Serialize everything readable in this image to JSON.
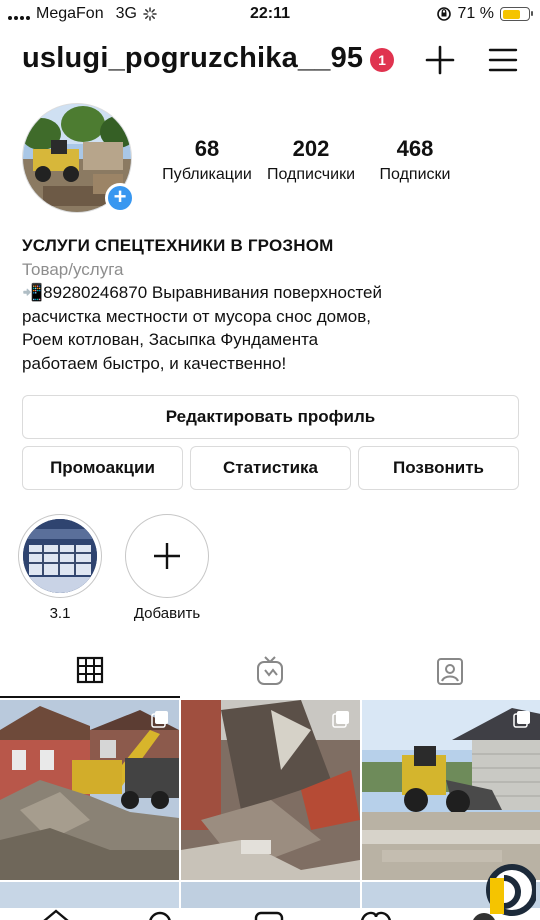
{
  "status_bar": {
    "carrier": "MegaFon",
    "network": "3G",
    "time": "22:11",
    "battery": "71 %",
    "battery_level": 0.71
  },
  "header": {
    "username": "uslugi_pogruzchika__95",
    "notification_count": "1",
    "icons": [
      "plus-icon",
      "menu-icon"
    ]
  },
  "profile": {
    "stats": [
      {
        "value": "68",
        "label": "Публикации"
      },
      {
        "value": "202",
        "label": "Подписчики"
      },
      {
        "value": "468",
        "label": "Подписки"
      }
    ]
  },
  "bio": {
    "name": "УСЛУГИ СПЕЦТЕХНИКИ В ГРОЗНОМ",
    "category": "Товар/услуга",
    "lines": [
      "📲89280246870 Выравнивания поверхностей",
      "расчистка местности от мусора снос домов,",
      "Роем котлован, Засыпка Фундамента",
      "работаем быстро, и качественно!"
    ]
  },
  "buttons": {
    "edit_profile": "Редактировать профиль",
    "promotions": "Промоакции",
    "insights": "Статистика",
    "call": "Позвонить"
  },
  "highlights": [
    {
      "label": "3.1"
    },
    {
      "label": "Добавить"
    }
  ],
  "tabs": [
    "grid-icon",
    "igtv-icon",
    "tagged-icon"
  ],
  "colors": {
    "badge": "#e0334f",
    "add_story": "#3897f0",
    "battery_fill": "#f5c400",
    "secondary_text": "#8e8e8e",
    "border": "#dbdbdb"
  }
}
